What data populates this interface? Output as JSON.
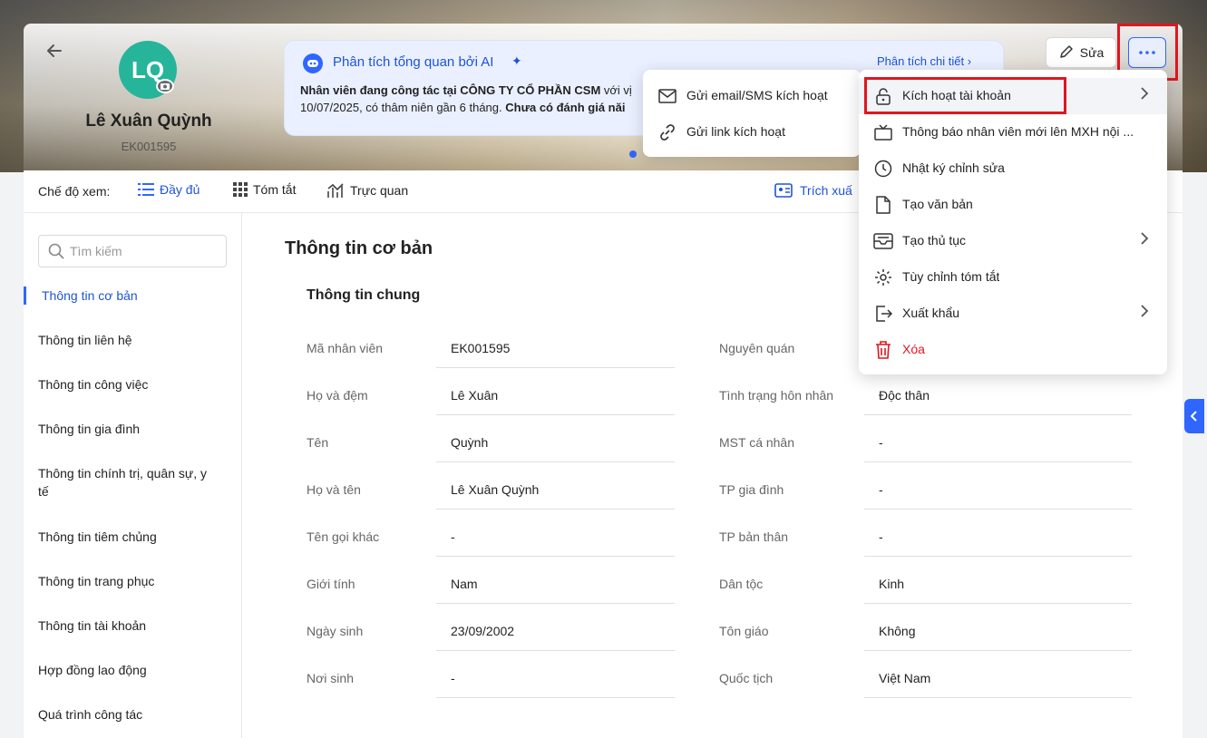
{
  "profile": {
    "initials": "LQ",
    "name": "Lê Xuân Quỳnh",
    "code": "EK001595"
  },
  "ai": {
    "title": "Phân tích tổng quan bởi AI",
    "detail_link": "Phân tích chi tiết",
    "text_part1": "Nhân viên đang công tác tại CÔNG TY CỔ PHẦN CSM",
    "text_part2": " với vị",
    "text_part3": "10/07/2025, có thâm niên gần 6 tháng. ",
    "text_part4": "Chưa có đánh giá năi"
  },
  "toolbar": {
    "edit_label": "Sửa"
  },
  "view": {
    "label": "Chế độ xem:",
    "options": [
      "Đầy đủ",
      "Tóm tắt",
      "Trực quan"
    ],
    "extract_label": "Trích xuấ"
  },
  "search": {
    "placeholder": "Tìm kiếm"
  },
  "sidebar": {
    "items": [
      "Thông tin cơ bản",
      "Thông tin liên hệ",
      "Thông tin công việc",
      "Thông tin gia đình",
      "Thông tin chính trị, quân sự, y tế",
      "Thông tin tiêm chủng",
      "Thông tin trang phục",
      "Thông tin tài khoản",
      "Hợp đồng lao động",
      "Quá trình công tác"
    ]
  },
  "section": {
    "title": "Thông tin cơ bản",
    "subtitle": "Thông tin chung"
  },
  "fields_left": [
    {
      "label": "Mã nhân viên",
      "value": "EK001595"
    },
    {
      "label": "Họ và đệm",
      "value": "Lê Xuân"
    },
    {
      "label": "Tên",
      "value": "Quỳnh"
    },
    {
      "label": "Họ và tên",
      "value": "Lê Xuân Quỳnh"
    },
    {
      "label": "Tên gọi khác",
      "value": "-"
    },
    {
      "label": "Giới tính",
      "value": "Nam"
    },
    {
      "label": "Ngày sinh",
      "value": "23/09/2002"
    },
    {
      "label": "Nơi sinh",
      "value": "-"
    }
  ],
  "fields_right": [
    {
      "label": "Nguyên quán",
      "value": ""
    },
    {
      "label": "Tình trạng hôn nhân",
      "value": "Độc thân"
    },
    {
      "label": "MST cá nhân",
      "value": "-"
    },
    {
      "label": "TP gia đình",
      "value": "-"
    },
    {
      "label": "TP bản thân",
      "value": "-"
    },
    {
      "label": "Dân tộc",
      "value": "Kinh"
    },
    {
      "label": "Tôn giáo",
      "value": "Không"
    },
    {
      "label": "Quốc tịch",
      "value": "Việt Nam"
    }
  ],
  "submenu": {
    "items": [
      "Gửi email/SMS kích hoạt",
      "Gửi link kích hoạt"
    ]
  },
  "menu": {
    "items": [
      {
        "label": "Kích hoạt tài khoản",
        "icon": "unlock-icon"
      },
      {
        "label": "Thông báo nhân viên mới lên MXH nội ...",
        "icon": "tv-icon"
      },
      {
        "label": "Nhật ký chỉnh sửa",
        "icon": "clock-icon"
      },
      {
        "label": "Tạo văn bản",
        "icon": "document-icon"
      },
      {
        "label": "Tạo thủ tục",
        "icon": "inbox-icon"
      },
      {
        "label": "Tùy chỉnh tóm tắt",
        "icon": "gear-icon"
      },
      {
        "label": "Xuất khẩu",
        "icon": "export-icon"
      },
      {
        "label": "Xóa",
        "icon": "trash-icon"
      }
    ]
  },
  "colors": {
    "accent": "#2f66ff",
    "link": "#1f53d8",
    "danger": "#e0161f",
    "avatar": "#26b59b"
  }
}
